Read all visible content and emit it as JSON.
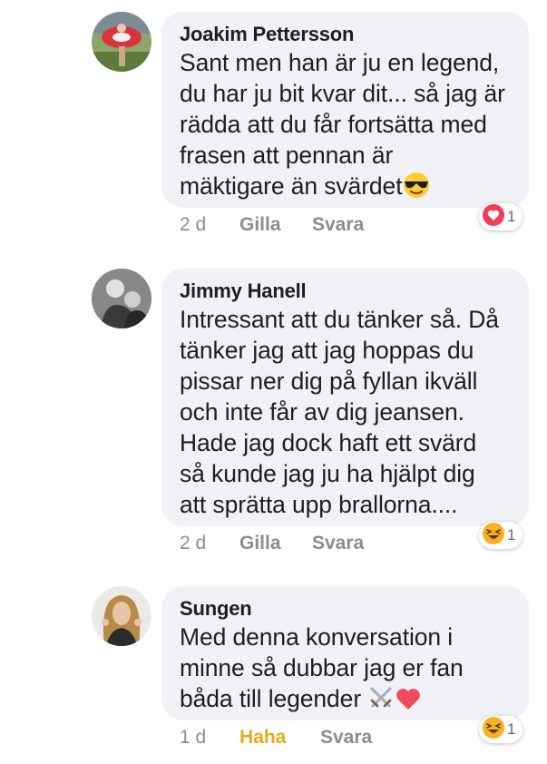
{
  "comments": [
    {
      "author": "Joakim Pettersson",
      "lines": [
        "Sant men han är ju en legend,",
        "du har ju bit kvar dit... så jag är",
        "rädda att du får fortsätta med",
        "frasen att pennan är",
        "mäktigare än svärdet"
      ],
      "trailing_emoji": "smiling-face-with-sunglasses",
      "time": "2 d",
      "like_label": "Gilla",
      "reply_label": "Svara",
      "reaction": "love",
      "reaction_count": "1",
      "colors": {
        "reaction": "#f33e58"
      }
    },
    {
      "author": "Jimmy Hanell",
      "lines": [
        "Intressant att du tänker så. Då",
        "tänker jag att jag hoppas du",
        "pissar ner dig på fyllan ikväll",
        "och inte får av dig jeansen.",
        "Hade jag dock haft ett svärd",
        "så kunde jag ju ha hjälpt dig",
        "att sprätta upp brallorna...."
      ],
      "time": "2 d",
      "like_label": "Gilla",
      "reply_label": "Svara",
      "reaction": "haha",
      "reaction_count": "1",
      "colors": {
        "reaction": "#f7b125"
      }
    },
    {
      "author": "Sungen",
      "lines": [
        "Med denna konversation i",
        "minne så dubbar jag er fan",
        "båda till legender"
      ],
      "trailing_emoji": "crossed-swords-and-red-heart",
      "time": "1 d",
      "like_label": "Haha",
      "reply_label": "Svara",
      "reaction": "haha",
      "reaction_count": "1",
      "colors": {
        "reaction": "#f7b125",
        "active_action": "#e9a71c"
      }
    }
  ]
}
